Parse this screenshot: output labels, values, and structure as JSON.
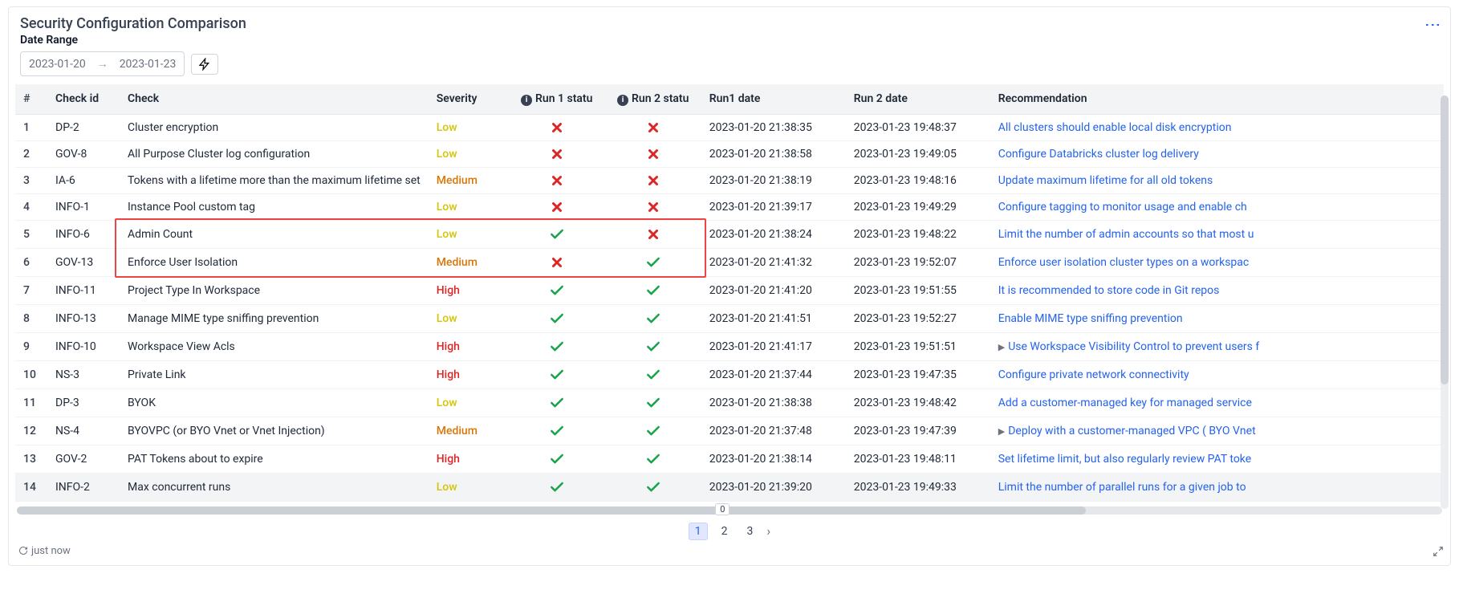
{
  "header": {
    "title": "Security Configuration Comparison",
    "date_label": "Date Range",
    "date_from": "2023-01-20",
    "date_to": "2023-01-23"
  },
  "columns": {
    "num": "#",
    "check_id": "Check id",
    "check": "Check",
    "severity": "Severity",
    "run1_status": "Run 1 statu",
    "run2_status": "Run 2 statu",
    "run1_date": "Run1 date",
    "run2_date": "Run 2 date",
    "recommendation": "Recommendation"
  },
  "rows": [
    {
      "n": "1",
      "id": "DP-2",
      "check": "Cluster encryption",
      "sev": "Low",
      "r1": "fail",
      "r2": "fail",
      "d1": "2023-01-20 21:38:35",
      "d2": "2023-01-23 19:48:37",
      "rec": "All clusters should enable local disk encryption",
      "expand": false
    },
    {
      "n": "2",
      "id": "GOV-8",
      "check": "All Purpose Cluster log configuration",
      "sev": "Low",
      "r1": "fail",
      "r2": "fail",
      "d1": "2023-01-20 21:38:58",
      "d2": "2023-01-23 19:49:05",
      "rec": "Configure Databricks cluster log delivery",
      "expand": false
    },
    {
      "n": "3",
      "id": "IA-6",
      "check": "Tokens with a lifetime more than the maximum lifetime set",
      "sev": "Medium",
      "r1": "fail",
      "r2": "fail",
      "d1": "2023-01-20 21:38:19",
      "d2": "2023-01-23 19:48:16",
      "rec": "Update maximum lifetime for all old tokens",
      "expand": false
    },
    {
      "n": "4",
      "id": "INFO-1",
      "check": "Instance Pool custom tag",
      "sev": "Low",
      "r1": "fail",
      "r2": "fail",
      "d1": "2023-01-20 21:39:17",
      "d2": "2023-01-23 19:49:29",
      "rec": "Configure tagging to monitor usage and enable ch",
      "expand": false
    },
    {
      "n": "5",
      "id": "INFO-6",
      "check": "Admin Count",
      "sev": "Low",
      "r1": "pass",
      "r2": "fail",
      "d1": "2023-01-20 21:38:24",
      "d2": "2023-01-23 19:48:22",
      "rec": "Limit the number of admin accounts so that most u",
      "expand": false
    },
    {
      "n": "6",
      "id": "GOV-13",
      "check": "Enforce User Isolation",
      "sev": "Medium",
      "r1": "fail",
      "r2": "pass",
      "d1": "2023-01-20 21:41:32",
      "d2": "2023-01-23 19:52:07",
      "rec": "Enforce user isolation cluster types on a workspac",
      "expand": false
    },
    {
      "n": "7",
      "id": "INFO-11",
      "check": "Project Type In Workspace",
      "sev": "High",
      "r1": "pass",
      "r2": "pass",
      "d1": "2023-01-20 21:41:20",
      "d2": "2023-01-23 19:51:55",
      "rec": "It is recommended to store code in Git repos",
      "expand": false
    },
    {
      "n": "8",
      "id": "INFO-13",
      "check": "Manage MIME type sniffing prevention",
      "sev": "Low",
      "r1": "pass",
      "r2": "pass",
      "d1": "2023-01-20 21:41:51",
      "d2": "2023-01-23 19:52:27",
      "rec": "Enable MIME type sniffing prevention",
      "expand": false
    },
    {
      "n": "9",
      "id": "INFO-10",
      "check": "Workspace View Acls",
      "sev": "High",
      "r1": "pass",
      "r2": "pass",
      "d1": "2023-01-20 21:41:17",
      "d2": "2023-01-23 19:51:51",
      "rec": "Use Workspace Visibility Control to prevent users f",
      "expand": true
    },
    {
      "n": "10",
      "id": "NS-3",
      "check": "Private Link",
      "sev": "High",
      "r1": "pass",
      "r2": "pass",
      "d1": "2023-01-20 21:37:44",
      "d2": "2023-01-23 19:47:35",
      "rec": "Configure private network connectivity",
      "expand": false
    },
    {
      "n": "11",
      "id": "DP-3",
      "check": "BYOK",
      "sev": "Low",
      "r1": "pass",
      "r2": "pass",
      "d1": "2023-01-20 21:38:38",
      "d2": "2023-01-23 19:48:42",
      "rec": "Add a customer-managed key for managed service",
      "expand": false
    },
    {
      "n": "12",
      "id": "NS-4",
      "check": "BYOVPC (or BYO Vnet or Vnet Injection)",
      "sev": "Medium",
      "r1": "pass",
      "r2": "pass",
      "d1": "2023-01-20 21:37:48",
      "d2": "2023-01-23 19:47:39",
      "rec": "Deploy with a customer-managed VPC ( BYO Vnet",
      "expand": true
    },
    {
      "n": "13",
      "id": "GOV-2",
      "check": "PAT Tokens about to expire",
      "sev": "High",
      "r1": "pass",
      "r2": "pass",
      "d1": "2023-01-20 21:38:14",
      "d2": "2023-01-23 19:48:11",
      "rec": "Set lifetime limit, but also regularly review PAT toke",
      "expand": false
    },
    {
      "n": "14",
      "id": "INFO-2",
      "check": "Max concurrent runs",
      "sev": "Low",
      "r1": "pass",
      "r2": "pass",
      "d1": "2023-01-20 21:39:20",
      "d2": "2023-01-23 19:49:33",
      "rec": "Limit the number of parallel runs for a given job to",
      "expand": false
    }
  ],
  "pagination": {
    "pages": [
      "1",
      "2",
      "3"
    ],
    "active": "1"
  },
  "scroll_badge": "0",
  "footer": {
    "refresh_text": "just now"
  },
  "highlight": {
    "start_row": "5",
    "end_row": "6"
  }
}
